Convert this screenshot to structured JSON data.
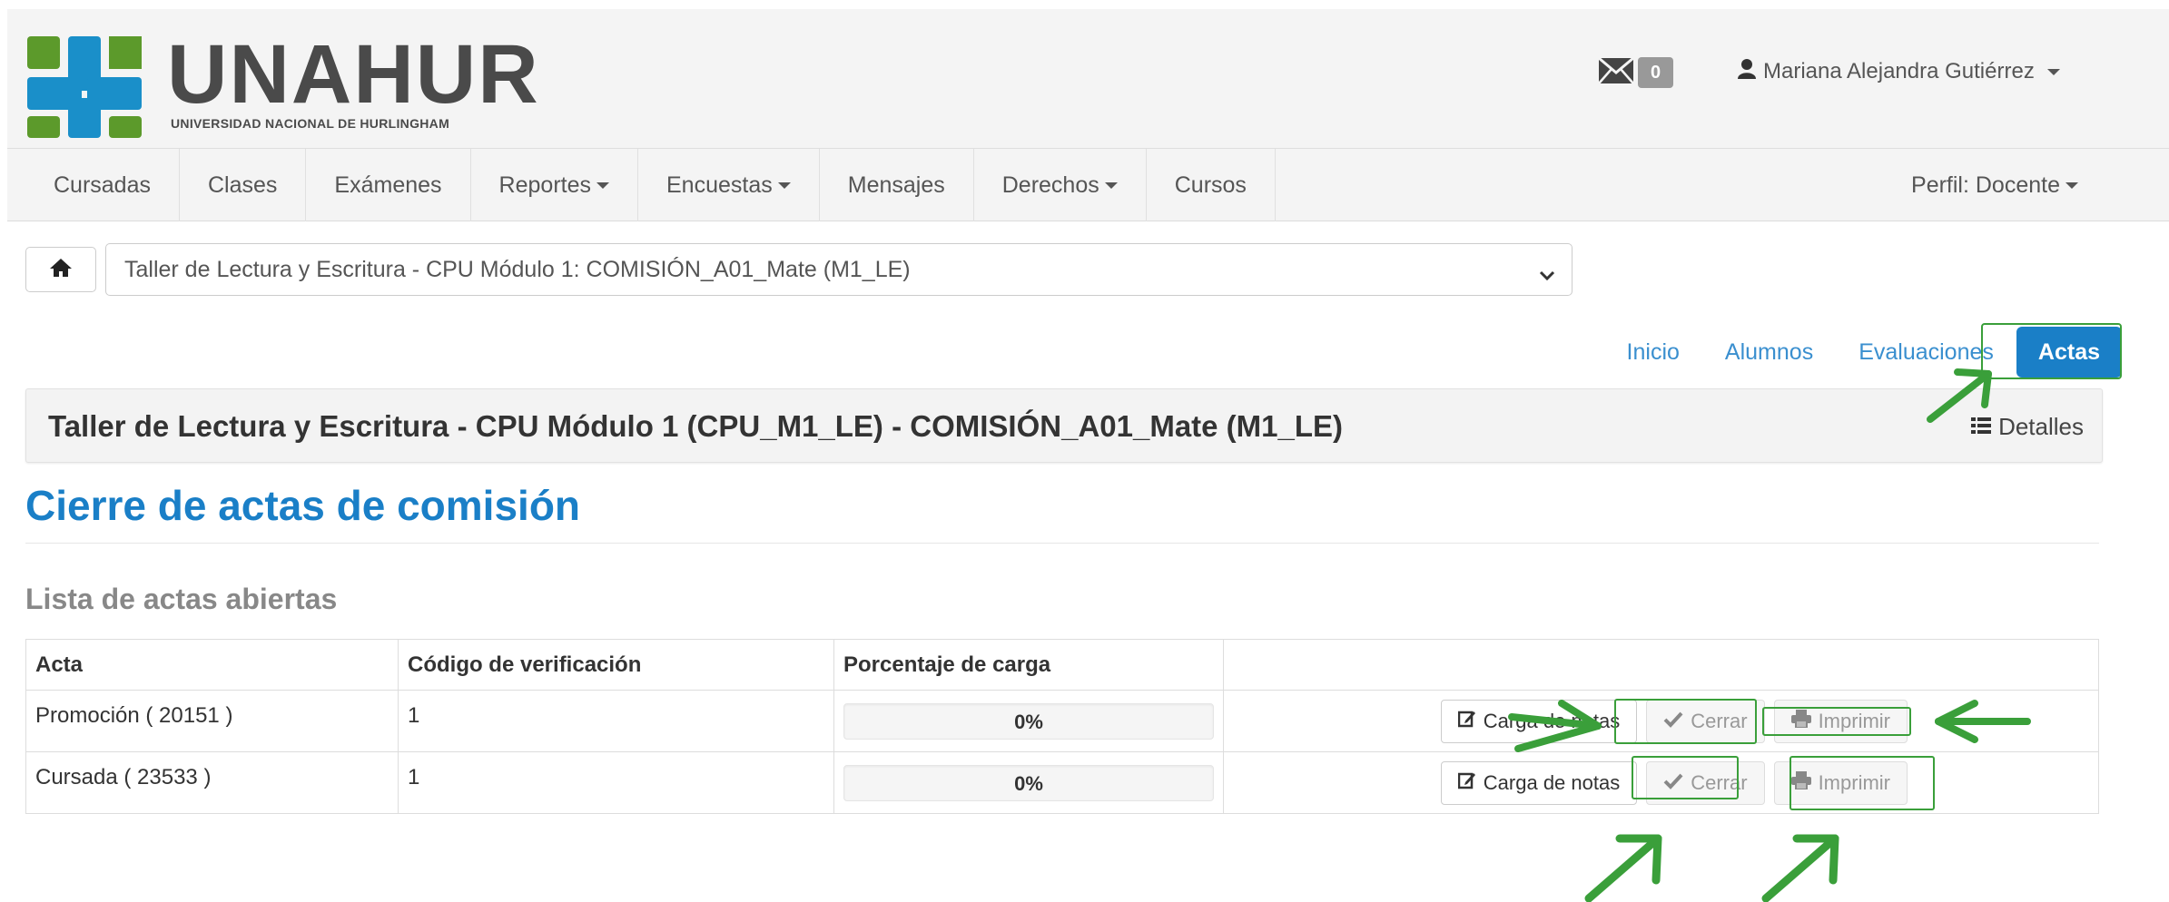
{
  "header": {
    "logo": {
      "name": "UNAHUR",
      "subtitle": "UNIVERSIDAD NACIONAL DE HURLINGHAM"
    },
    "mail_count": "0",
    "user_name": "Mariana Alejandra Gutiérrez"
  },
  "nav": {
    "items": [
      "Cursadas",
      "Clases",
      "Exámenes",
      "Reportes",
      "Encuestas",
      "Mensajes",
      "Derechos",
      "Cursos"
    ],
    "perfil": "Perfil: Docente"
  },
  "course_select": {
    "value": "Taller de Lectura y Escritura - CPU Módulo 1: COMISIÓN_A01_Mate (M1_LE)"
  },
  "tabs": {
    "items": [
      "Inicio",
      "Alumnos",
      "Evaluaciones",
      "Actas"
    ],
    "active": "Actas"
  },
  "course_bar": {
    "title": "Taller de Lectura y Escritura - CPU Módulo 1 (CPU_M1_LE) - COMISIÓN_A01_Mate (M1_LE)",
    "details": "Detalles"
  },
  "page": {
    "title": "Cierre de actas de comisión",
    "section_title": "Lista de actas abiertas"
  },
  "table": {
    "headers": [
      "Acta",
      "Código de verificación",
      "Porcentaje de carga",
      ""
    ],
    "rows": [
      {
        "acta": "Promoción ( 20151 )",
        "codigo": "1",
        "porcentaje": "0%",
        "fill": 0
      },
      {
        "acta": "Cursada ( 23533 )",
        "codigo": "1",
        "porcentaje": "0%",
        "fill": 0
      }
    ],
    "buttons": {
      "carga": "Carga de notas",
      "cerrar": "Cerrar",
      "imprimir": "Imprimir"
    }
  },
  "colors": {
    "accent": "#1a7fc7",
    "annotation": "#3a9f3a"
  }
}
